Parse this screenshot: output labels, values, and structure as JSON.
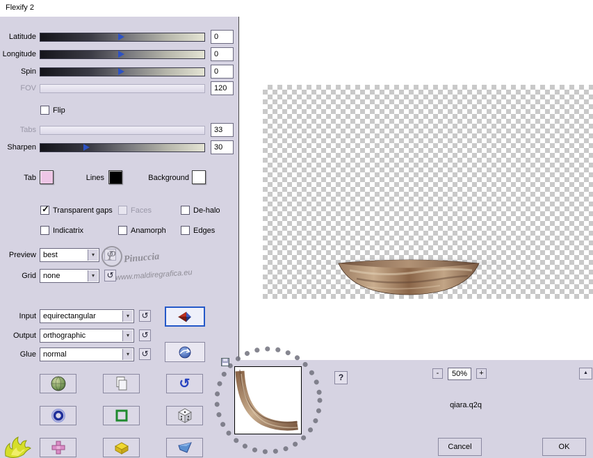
{
  "window": {
    "title": "Flexify 2"
  },
  "icons": {
    "dropdown_arrow": "▾",
    "undo": "↺",
    "check": "✓"
  },
  "sliders": [
    {
      "label": "Latitude",
      "value": "0",
      "pos": 49,
      "disabled": false
    },
    {
      "label": "Longitude",
      "value": "0",
      "pos": 49,
      "disabled": false
    },
    {
      "label": "Spin",
      "value": "0",
      "pos": 49,
      "disabled": false
    },
    {
      "label": "FOV",
      "value": "120",
      "pos": null,
      "disabled": true
    },
    {
      "label": "Tabs",
      "value": "33",
      "pos": null,
      "disabled": true
    },
    {
      "label": "Sharpen",
      "value": "30",
      "pos": 28,
      "disabled": false
    }
  ],
  "flip": {
    "label": "Flip",
    "checked": false
  },
  "swatches": [
    {
      "label": "Tab",
      "color": "#eec6e6"
    },
    {
      "label": "Lines",
      "color": "#000000"
    },
    {
      "label": "Background",
      "color": "#ffffff"
    }
  ],
  "checkboxes": [
    {
      "label": "Transparent gaps",
      "checked": true,
      "disabled": false
    },
    {
      "label": "Faces",
      "checked": false,
      "disabled": true
    },
    {
      "label": "De-halo",
      "checked": false,
      "disabled": false
    },
    {
      "label": "Indicatrix",
      "checked": false,
      "disabled": false
    },
    {
      "label": "Anamorph",
      "checked": false,
      "disabled": false
    },
    {
      "label": "Edges",
      "checked": false,
      "disabled": false
    }
  ],
  "dropdowns": [
    {
      "label": "Preview",
      "value": "best"
    },
    {
      "label": "Grid",
      "value": "none"
    },
    {
      "label": "Input",
      "value": "equirectangular"
    },
    {
      "label": "Output",
      "value": "orthographic"
    },
    {
      "label": "Glue",
      "value": "normal"
    }
  ],
  "watermark": {
    "initial": "P",
    "name": "Pinuccia",
    "url": "www.maldiregrafica.eu"
  },
  "preview": {
    "zoom": "50%",
    "zoom_out": "-",
    "zoom_in": "+",
    "help": "?",
    "scroll_up": "▲",
    "filename": "qiara.q2q"
  },
  "actions": {
    "cancel": "Cancel",
    "ok": "OK"
  }
}
